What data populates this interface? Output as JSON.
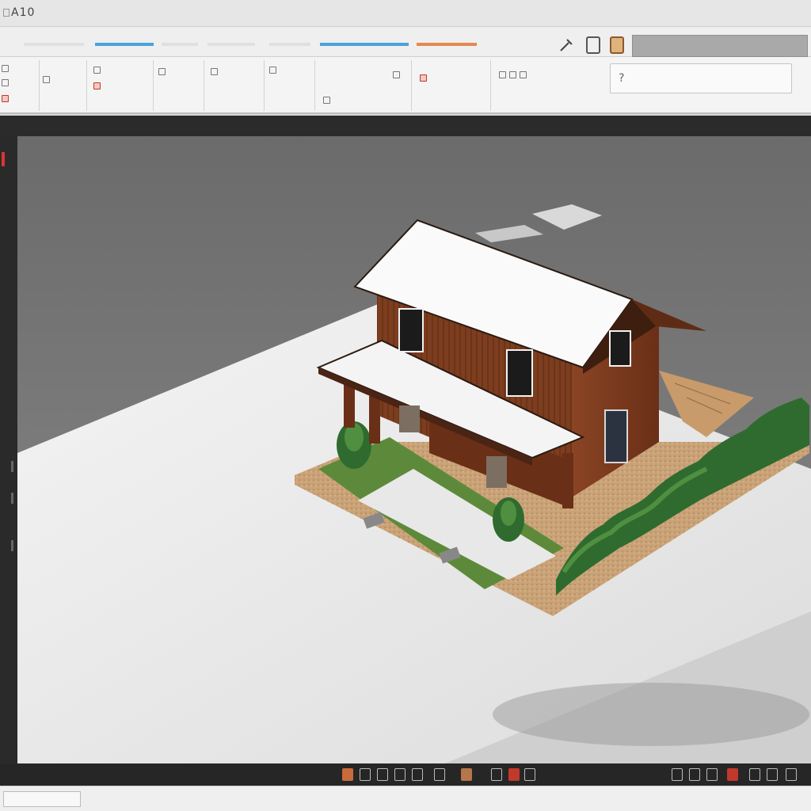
{
  "window": {
    "title": "A10"
  },
  "ribbon_tabs": [
    {
      "label": ""
    },
    {
      "label": ""
    },
    {
      "label": ""
    },
    {
      "label": ""
    },
    {
      "label": ""
    },
    {
      "label": ""
    },
    {
      "label": ""
    },
    {
      "label": ""
    }
  ],
  "search": {
    "placeholder": "",
    "glyph": "?"
  },
  "strip": {
    "left_label": "",
    "middle_label": "",
    "right_label": ""
  },
  "properties": [],
  "status": {
    "text": ""
  },
  "colors": {
    "viewport_bg": "#6f6f6f",
    "wall_wood": "#7a3b1e",
    "roof": "#fafafa",
    "accent_red": "#c0392b",
    "accent_blue": "#4aa3d9",
    "hedge": "#2f6b2f",
    "mulch": "#c8a070"
  }
}
